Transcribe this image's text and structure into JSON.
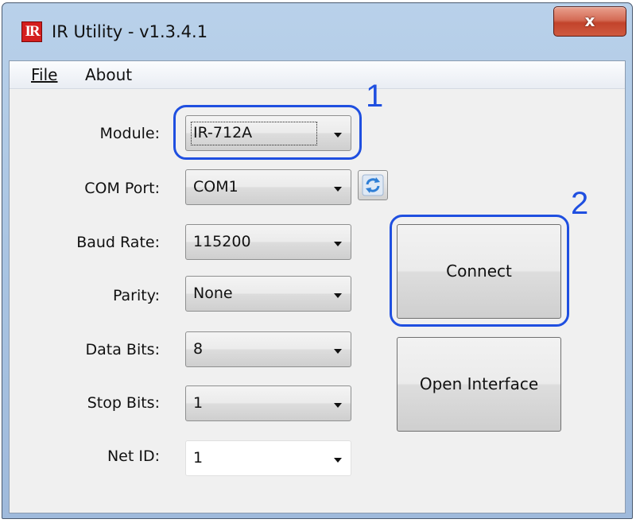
{
  "window": {
    "title": "IR Utility - v1.3.4.1",
    "icon_text": "IR",
    "close_glyph": "x"
  },
  "menu": {
    "file": "File",
    "about": "About"
  },
  "form": {
    "module": {
      "label": "Module:",
      "value": "IR-712A"
    },
    "com_port": {
      "label": "COM Port:",
      "value": "COM1"
    },
    "baud_rate": {
      "label": "Baud Rate:",
      "value": "115200"
    },
    "parity": {
      "label": "Parity:",
      "value": "None"
    },
    "data_bits": {
      "label": "Data Bits:",
      "value": "8"
    },
    "stop_bits": {
      "label": "Stop Bits:",
      "value": "1"
    },
    "net_id": {
      "label": "Net ID:",
      "value": "1"
    }
  },
  "buttons": {
    "connect": "Connect",
    "open_interface": "Open Interface",
    "refresh_icon": "refresh-icon"
  },
  "annotations": {
    "callout_1": "1",
    "callout_2": "2",
    "highlight_color": "#1f4fe0"
  },
  "colors": {
    "title_bar": "#b9d1ea",
    "close_button": "#c2432b",
    "app_icon": "#d41e1e"
  }
}
